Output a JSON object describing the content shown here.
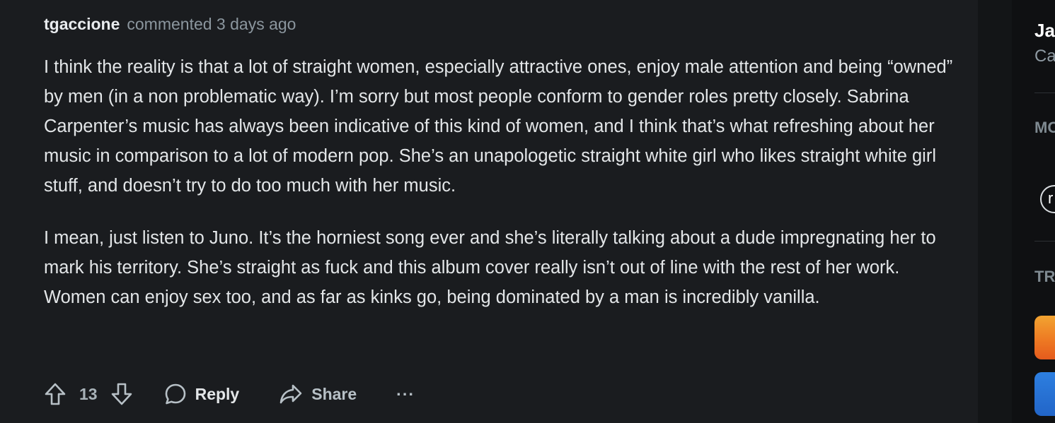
{
  "comment": {
    "author": "tgaccione",
    "meta": "commented 3 days ago",
    "paragraphs": [
      "I think the reality is that a lot of straight women, especially attractive ones, enjoy male attention and being “owned” by men (in a non problematic way). I’m sorry but most people conform to gender roles pretty closely. Sabrina Carpenter’s music has always been indicative of this kind of women, and I think that’s what refreshing about her music in comparison to a lot of modern pop. She’s an unapologetic straight white girl who likes straight white girl stuff, and doesn’t try to do too much with her music.",
      "I mean, just listen to Juno. It’s the horniest song ever and she’s literally talking about a dude impregnating her to mark his territory. She’s straight as fuck and this album cover really isn’t out of line with the rest of her work. Women can enjoy sex too, and as far as kinks go, being dominated by a man is incredibly vanilla."
    ],
    "actions": {
      "vote_count": "13",
      "reply_label": "Reply",
      "share_label": "Share",
      "more_label": "···"
    }
  },
  "sidebar": {
    "title_fragment": "Ja",
    "subtitle_fragment": "Ca",
    "section1_fragment": "MO",
    "circle_fragment": "r",
    "section2_fragment": "TR"
  },
  "icons": {
    "upvote": "arrow-up-outline-icon",
    "downvote": "arrow-down-outline-icon",
    "reply": "speech-bubble-icon",
    "share": "share-arrow-icon",
    "more": "ellipsis-icon"
  },
  "colors": {
    "background": "#1a1c1f",
    "username": "#e9ecef",
    "meta": "#8b969e",
    "body_text": "#e3e6e8",
    "action_text": "#b7c0c6"
  }
}
